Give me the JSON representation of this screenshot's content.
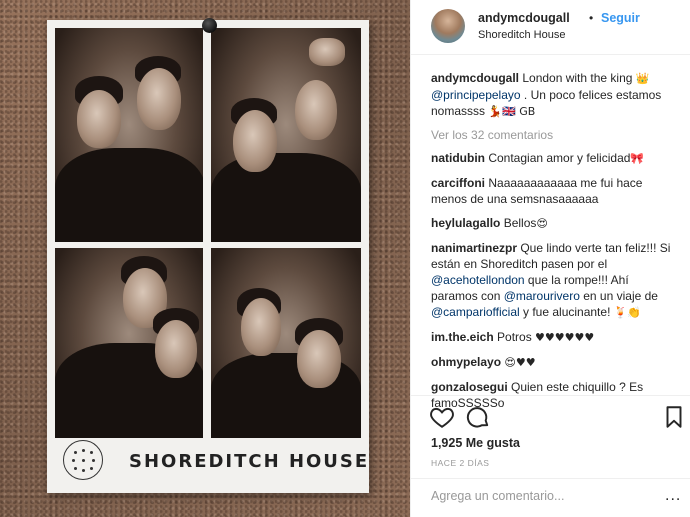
{
  "photo": {
    "strip_title": "SHOREDITCH HOUSE"
  },
  "header": {
    "username": "andymcdougall",
    "separator": "•",
    "follow_label": "Seguir",
    "location": "Shoreditch House"
  },
  "caption": {
    "username": "andymcdougall",
    "text_before": " London with the king ",
    "emoji_crown": "👑",
    "mention": "@principepelayo",
    "text_after": " . Un poco felices estamos nomassss ",
    "emoji_tail": "💃🇬🇧 GB"
  },
  "view_more": "Ver los 32 comentarios",
  "comments": [
    {
      "user": "natidubin",
      "text": " Contagian amor y felicidad",
      "emoji": "🎀"
    },
    {
      "user": "carciffoni",
      "text": " Naaaaaaaaaaaa me fui hace menos de una semsnasaaaaaa",
      "emoji": ""
    },
    {
      "user": "heylulagallo",
      "text": " Bellos",
      "emoji": "😍"
    },
    {
      "user": "nanimartinezpr",
      "text": " Que lindo verte tan feliz!!! Si están en Shoreditch pasen por el ",
      "mention1": "@acehotellondon",
      "text2": " que la rompe!!! Ahí paramos con ",
      "mention2": "@marourivero",
      "text3": " en un viaje de ",
      "mention3": "@campariofficial",
      "text4": " y fue alucinante! ",
      "emoji": "🍹👏"
    },
    {
      "user": "im.the.eich",
      "text": " Potros ",
      "emoji": "♥♥♥♥♥♥"
    },
    {
      "user": "ohmypelayo",
      "text": " ",
      "emoji": "😍♥♥"
    },
    {
      "user": "gonzalosegui",
      "text": " Quien este chiquillo ? Es famoSSSSSo",
      "emoji": ""
    }
  ],
  "actions": {
    "like_icon": "heart-icon",
    "comment_icon": "comment-icon",
    "save_icon": "bookmark-icon",
    "likes": "1,925 Me gusta",
    "time": "HACE 2 DÍAS"
  },
  "add_comment": {
    "placeholder": "Agrega un comentario...",
    "more_icon": "..."
  },
  "colors": {
    "link_blue": "#3897f0",
    "mention": "#003569",
    "muted": "#999999"
  }
}
